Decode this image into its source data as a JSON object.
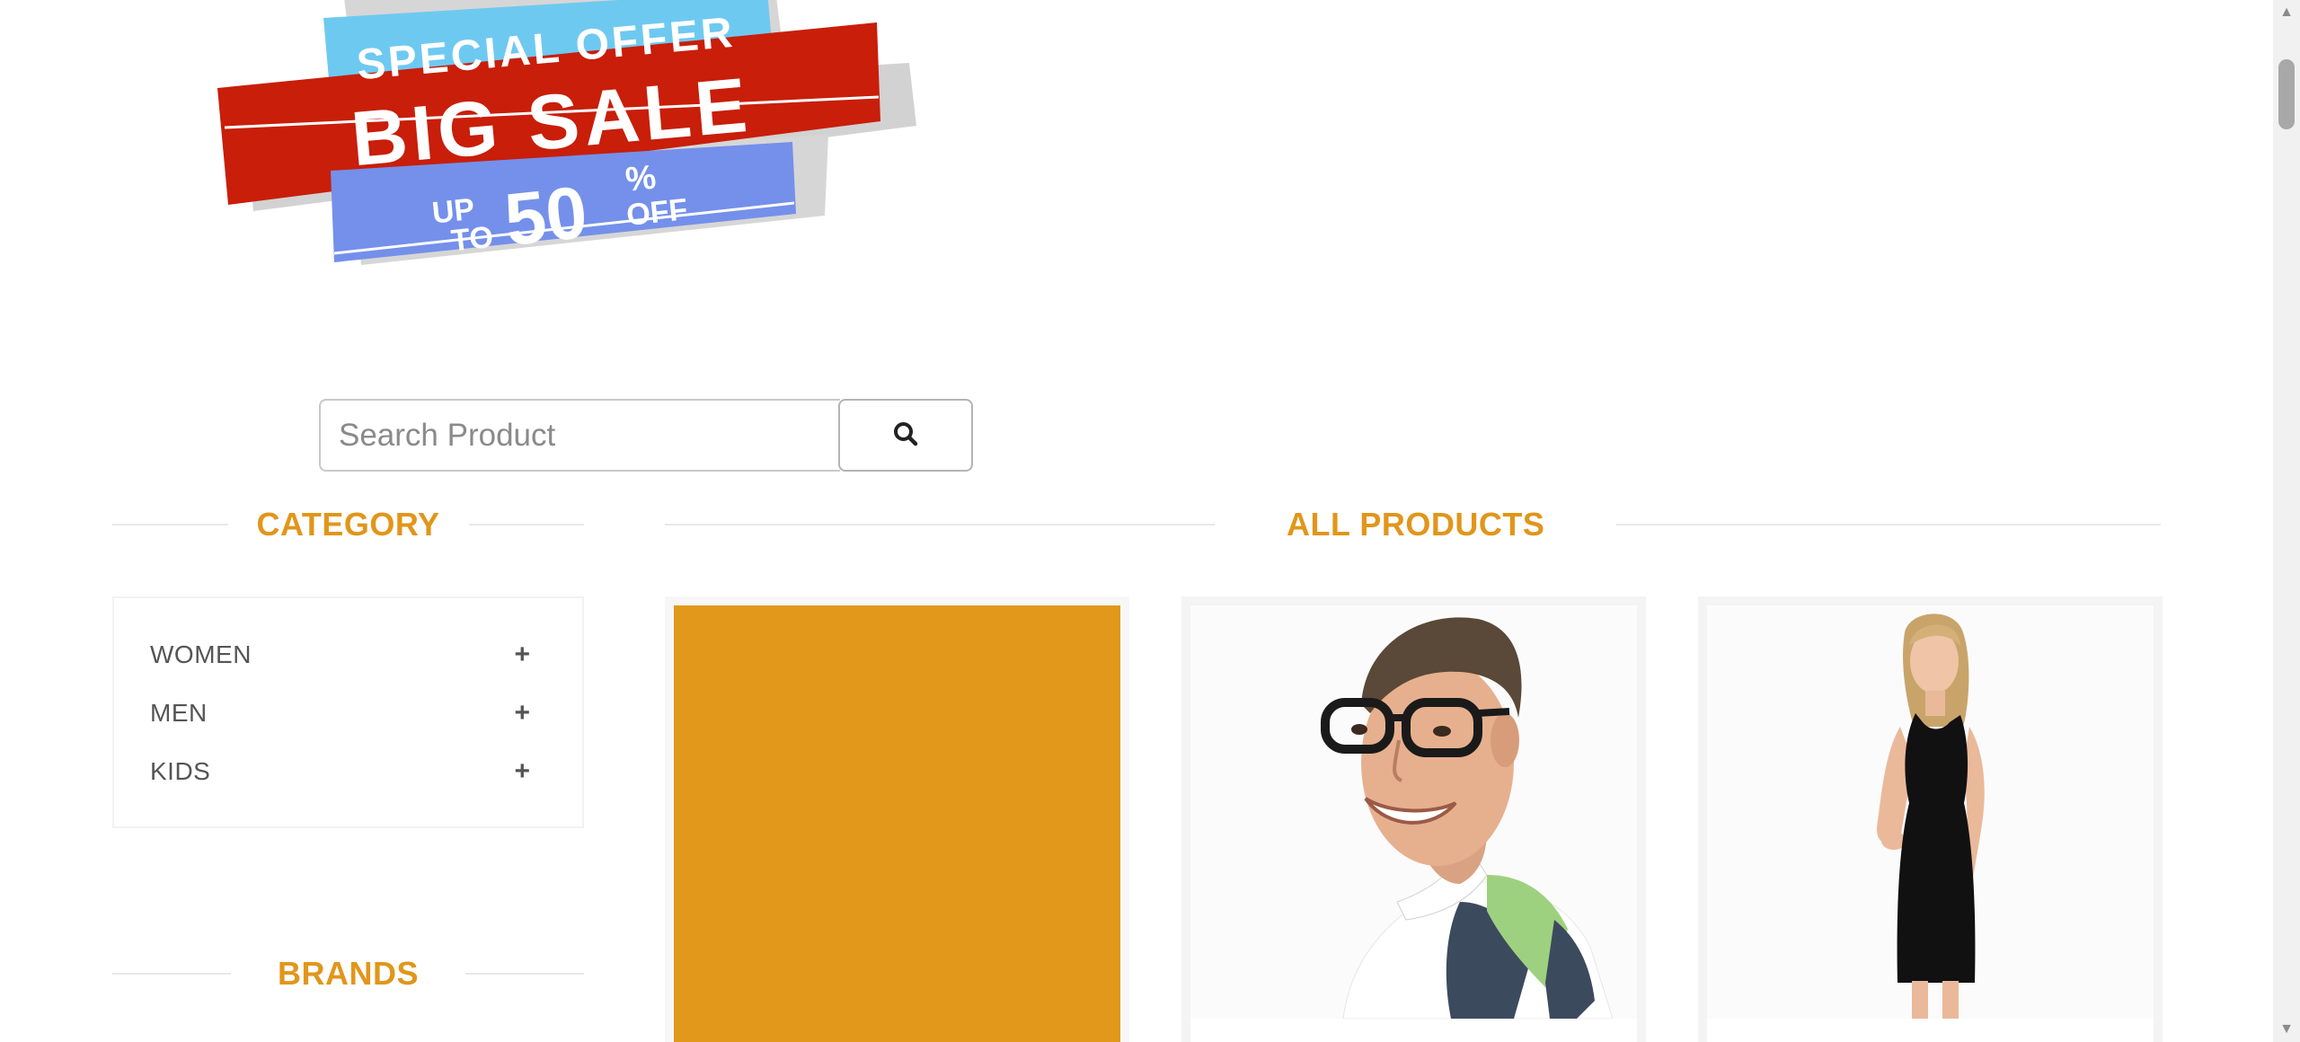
{
  "banner": {
    "line1": "SPECIAL OFFER",
    "line2": "BIG SALE",
    "up_to": "UP",
    "to": "TO",
    "percent_value": "50",
    "percent_sign": "%",
    "off": "OFF"
  },
  "search": {
    "placeholder": "Search Product",
    "value": "",
    "button_icon": "search-icon"
  },
  "sections": {
    "category_title": "CATEGORY",
    "all_products_title": "ALL PRODUCTS",
    "brands_title": "BRANDS"
  },
  "categories": [
    {
      "label": "WOMEN",
      "expand_icon": "plus-icon",
      "expand_glyph": "+"
    },
    {
      "label": "MEN",
      "expand_icon": "plus-icon",
      "expand_glyph": "+"
    },
    {
      "label": "KIDS",
      "expand_icon": "plus-icon",
      "expand_glyph": "+"
    }
  ],
  "products": [
    {
      "image": "orange-placeholder"
    },
    {
      "image": "man-with-glasses-photo"
    },
    {
      "image": "woman-in-black-dress-photo"
    }
  ],
  "colors": {
    "accent": "#e1961b",
    "placeholder_orange": "#e1981b",
    "banner_red": "#c81e0a",
    "banner_light_blue": "#6ec9f1",
    "banner_blue": "#7490ea"
  }
}
